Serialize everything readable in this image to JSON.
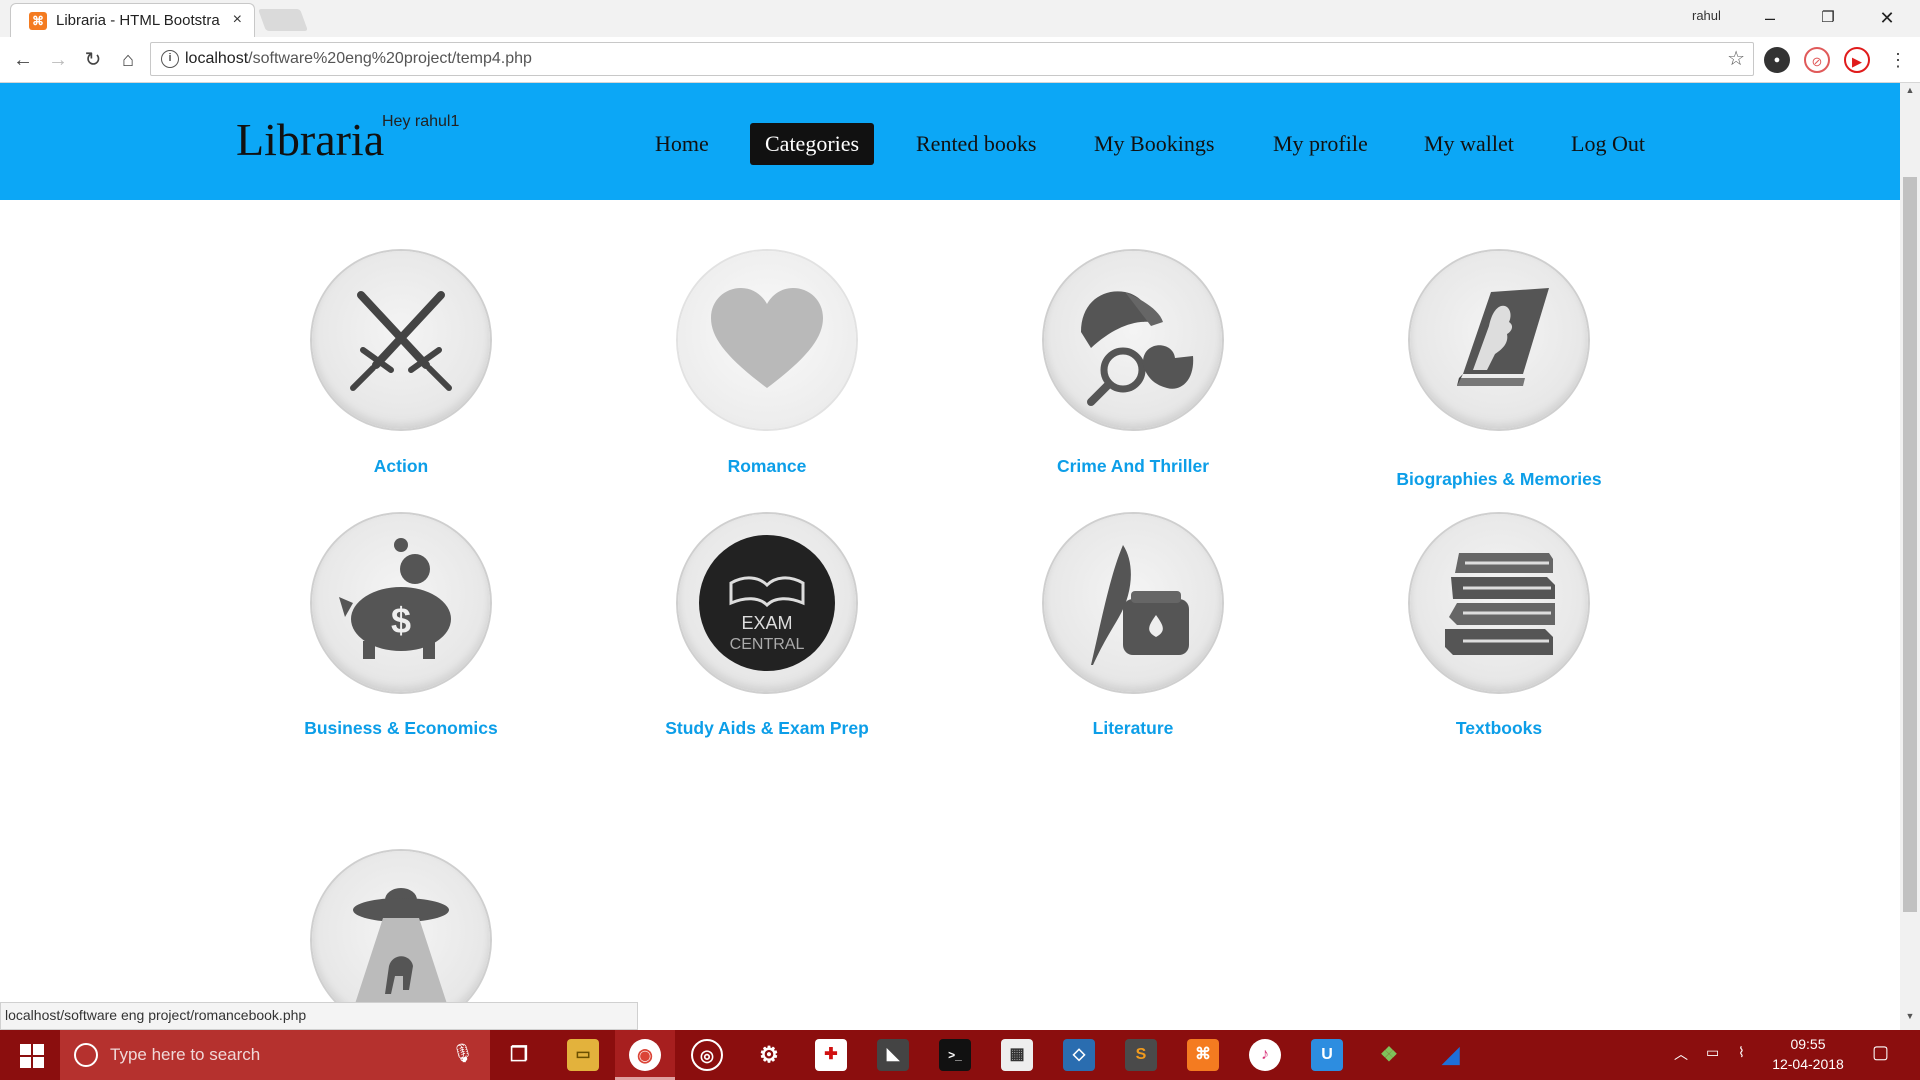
{
  "browser": {
    "tab_title": "Libraria - HTML Bootstra",
    "tab_close": "×",
    "profile_name": "rahul",
    "url_host": "localhost",
    "url_path": "/software%20eng%20project/temp4.php",
    "status_url": "localhost/software eng project/romancebook.php"
  },
  "navbar": {
    "brand": "Libraria",
    "greeting": "Hey rahul1",
    "links": [
      {
        "label": "Home",
        "active": false
      },
      {
        "label": "Categories",
        "active": true
      },
      {
        "label": "Rented books",
        "active": false
      },
      {
        "label": "My Bookings",
        "active": false
      },
      {
        "label": "My profile",
        "active": false
      },
      {
        "label": "My wallet",
        "active": false
      },
      {
        "label": "Log Out",
        "active": false
      }
    ]
  },
  "categories": [
    {
      "label": "Action",
      "icon": "crossed-swords-icon"
    },
    {
      "label": "Romance",
      "icon": "heart-icon"
    },
    {
      "label": "Crime And Thriller",
      "icon": "detective-hat-pipe-icon"
    },
    {
      "label": "Biographies & Memories",
      "icon": "book-profile-icon"
    },
    {
      "label": "Business & Economics",
      "icon": "piggy-bank-icon"
    },
    {
      "label": "Study Aids & Exam Prep",
      "icon": "exam-central-icon",
      "icon_text": [
        "EXAM",
        "CENTRAL"
      ]
    },
    {
      "label": "Literature",
      "icon": "quill-inkpot-icon"
    },
    {
      "label": "Textbooks",
      "icon": "book-stack-icon"
    },
    {
      "label": "",
      "icon": "ufo-abduction-icon"
    }
  ],
  "taskbar": {
    "search_placeholder": "Type here to search",
    "time": "09:55",
    "date": "12-04-2018"
  },
  "colors": {
    "navbar_bg": "#0ca7f6",
    "category_label": "#0c9ee8",
    "active_nav_bg": "#111111",
    "taskbar_bg": "#8b0e0e"
  }
}
